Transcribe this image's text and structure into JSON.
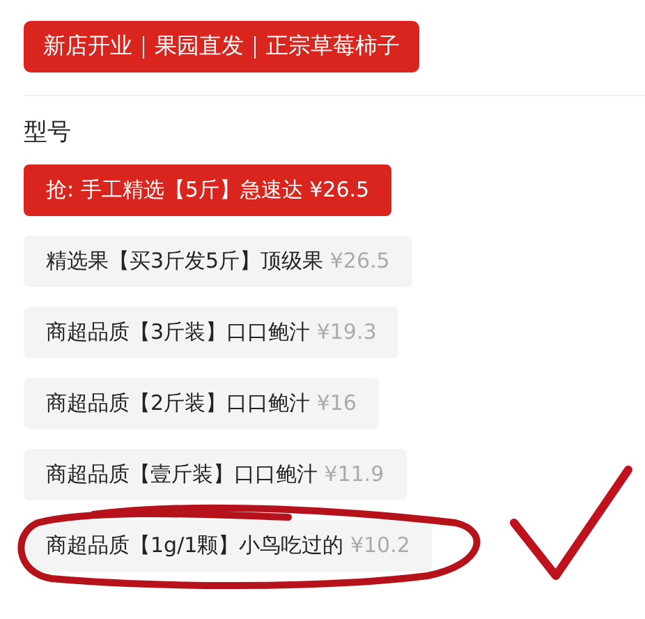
{
  "banner": "新店开业｜果园直发｜正宗草莓柿子",
  "section_title": "型号",
  "options": [
    {
      "name": "抢: 手工精选【5斤】急速达",
      "price": "¥26.5",
      "selected": true,
      "circled": false
    },
    {
      "name": "精选果【买3斤发5斤】顶级果",
      "price": "¥26.5",
      "selected": false,
      "circled": false
    },
    {
      "name": "商超品质【3斤装】口口鲍汁",
      "price": "¥19.3",
      "selected": false,
      "circled": false
    },
    {
      "name": "商超品质【2斤装】口口鲍汁",
      "price": "¥16",
      "selected": false,
      "circled": false
    },
    {
      "name": "商超品质【壹斤装】口口鲍汁",
      "price": "¥11.9",
      "selected": false,
      "circled": false
    },
    {
      "name": "商超品质【1g/1颗】小鸟吃过的",
      "price": "¥10.2",
      "selected": false,
      "circled": true
    }
  ]
}
